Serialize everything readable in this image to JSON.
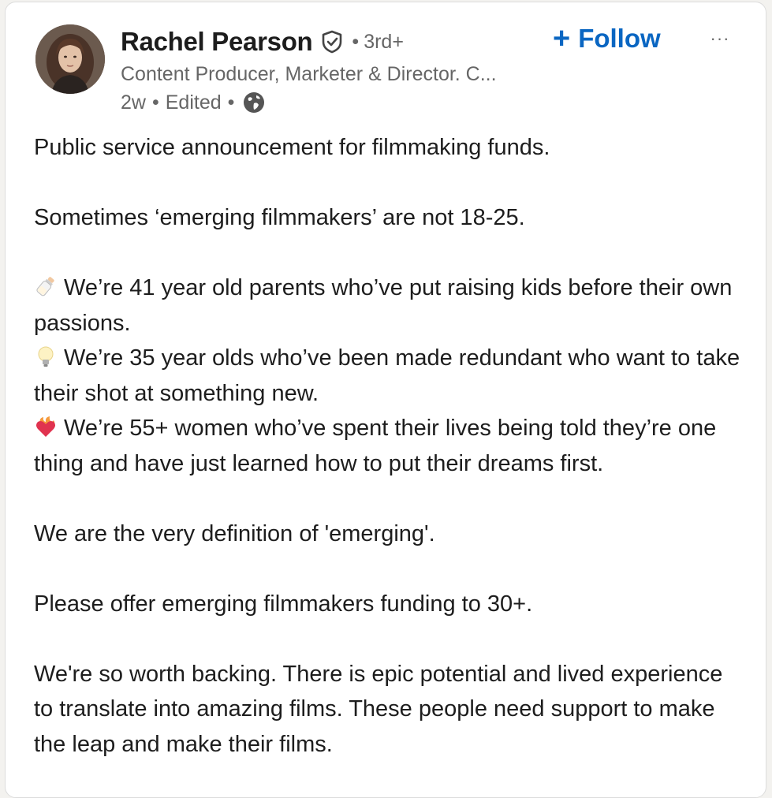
{
  "author": {
    "name": "Rachel Pearson",
    "degree_separator": "•",
    "degree": "3rd+",
    "headline": "Content Producer, Marketer & Director. C...",
    "time": "2w",
    "edited": "Edited",
    "meta_separator": "•",
    "visibility_icon": "globe-icon",
    "verified_icon": "verified-shield-icon"
  },
  "actions": {
    "follow_plus": "+",
    "follow_label": "Follow",
    "more_label": "···"
  },
  "post": {
    "p1": "Public service announcement for filmmaking funds.",
    "p2": "Sometimes ‘emerging filmmakers’ are not 18-25.",
    "item1": "We’re 41 year old parents who’ve put raising kids before their own passions.",
    "item1_icon": "baby-bottle-icon",
    "item2": "We’re 35 year olds who’ve been made redundant who want to take their shot at something new.",
    "item2_icon": "light-bulb-icon",
    "item3": "We’re 55+ women who’ve spent their lives being told they’re one thing and have just learned how to put their dreams first.",
    "item3_icon": "heart-on-fire-icon",
    "p3": "We are the very definition of 'emerging'.",
    "p4": "Please offer emerging filmmakers funding to 30+.",
    "p5": "We're so worth backing. There is epic potential and lived experience to translate into amazing films. These people need support to make the leap and make their films."
  },
  "colors": {
    "accent": "#0a66c2",
    "text_primary": "#1d1d1d",
    "text_secondary": "#666666"
  }
}
